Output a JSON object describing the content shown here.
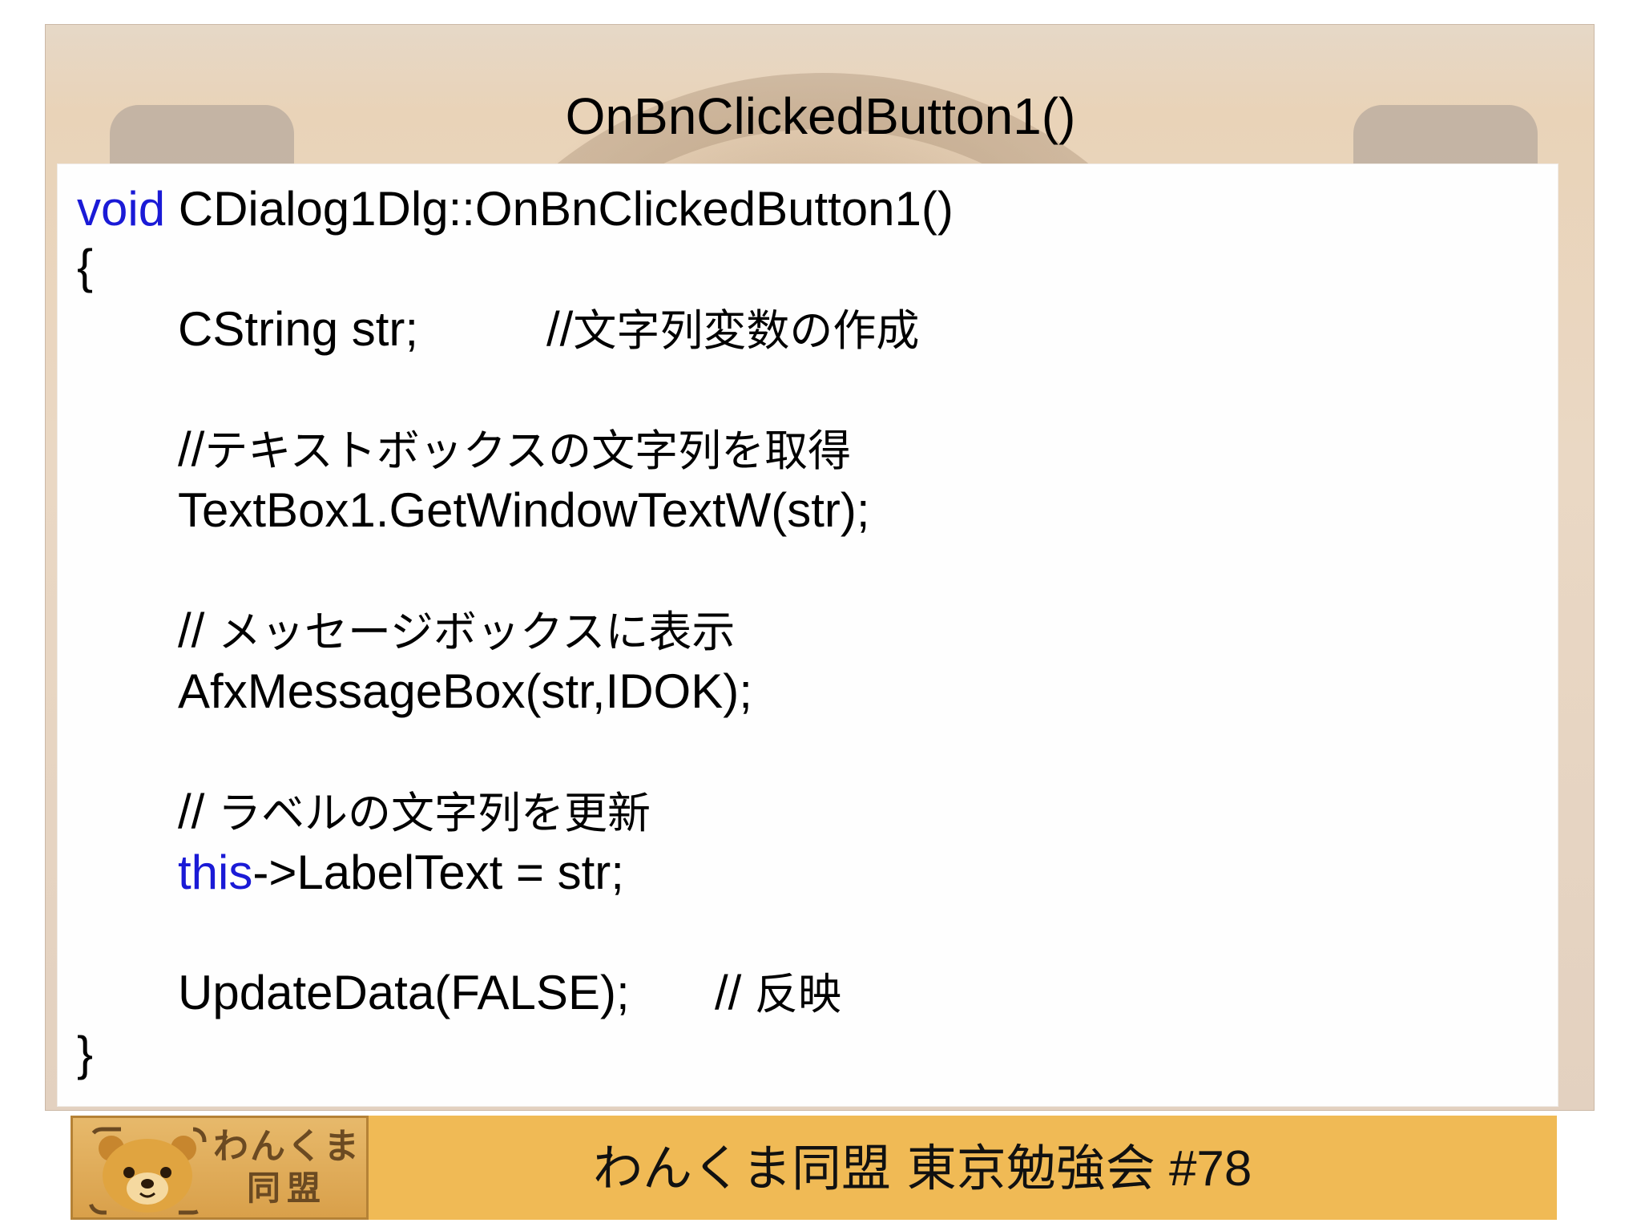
{
  "slide": {
    "title": "OnBnClickedButton1()"
  },
  "code": {
    "line1_keyword": "void",
    "line1_rest": " CDialog1Dlg::OnBnClickedButton1()",
    "open_brace": "{",
    "line3_code": "CString str;",
    "line3_comment_prefix": "//",
    "line3_comment_text": "文字列変数の作成",
    "line5_comment_prefix": "//",
    "line5_comment_text": "テキストボックスの文字列を取得",
    "line6_code": "TextBox1.GetWindowTextW(str);",
    "line8_comment_prefix": "// ",
    "line8_comment_text": "メッセージボックスに表示",
    "line9_code": "AfxMessageBox(str,IDOK);",
    "line11_comment_prefix": "// ",
    "line11_comment_text": "ラベルの文字列を更新",
    "line12_keyword": "this",
    "line12_rest": "->LabelText = str;",
    "line14_code": "UpdateData(FALSE);",
    "line14_comment_prefix": "// ",
    "line14_comment_text": "反映",
    "close_brace": "}"
  },
  "footer": {
    "text_jp": "わんくま同盟 東京勉強会",
    "text_num": " #78"
  },
  "logo": {
    "line1": "わんくま",
    "line2": "同盟"
  },
  "colors": {
    "keyword": "#1a1ad6",
    "footer_bar": "#f0ba55"
  }
}
